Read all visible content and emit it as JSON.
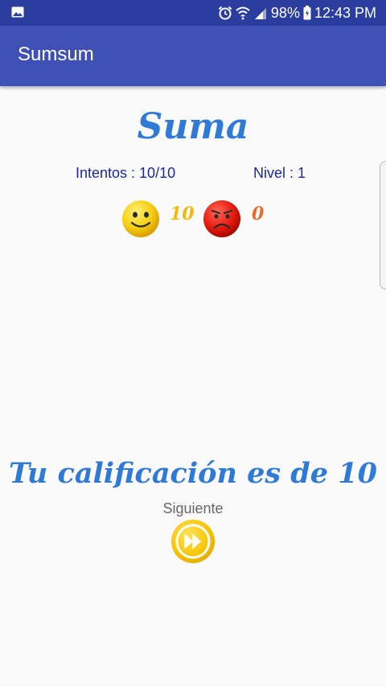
{
  "status_bar": {
    "battery": "98%",
    "time": "12:43 PM",
    "icons": [
      "gallery-icon",
      "alarm-icon",
      "wifi-icon",
      "signal-icon",
      "battery-icon"
    ]
  },
  "app_bar": {
    "title": "Sumsum"
  },
  "game": {
    "title": "Suma",
    "attempts": "Intentos : 10/10",
    "level": "Nivel : 1",
    "correct_count": "10",
    "wrong_count": "0"
  },
  "result": {
    "message": "Tu calificación es de 10",
    "next_label": "Siguiente"
  },
  "colors": {
    "status_bar": "#2b3ea0",
    "app_bar": "#3f51b5",
    "title_blue": "#2f7ad6",
    "label_blue": "#1a28a8",
    "correct_yellow": "#f3b90f",
    "wrong_orange": "#e26e31",
    "background": "#fafafa"
  }
}
